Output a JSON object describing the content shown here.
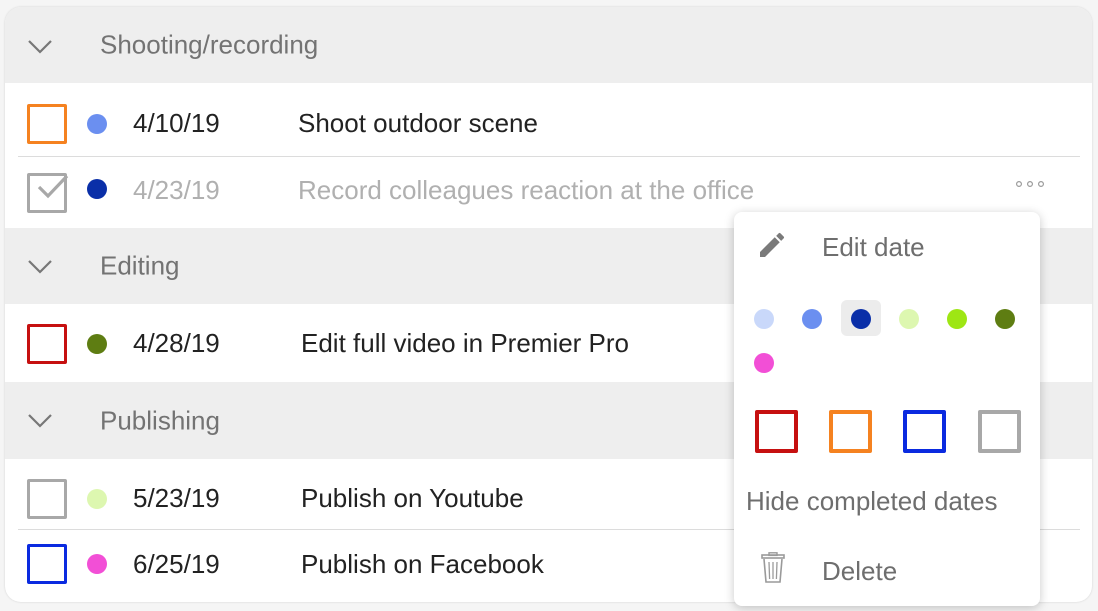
{
  "groups": [
    {
      "title": "Shooting/recording",
      "tasks": [
        {
          "date": "4/10/19",
          "label": "Shoot outdoor scene",
          "dot": "#6b8ff0",
          "box": "#f58220",
          "done": false
        },
        {
          "date": "4/23/19",
          "label": "Record colleagues reaction at the office",
          "dot": "#0a2fa8",
          "box": "#a8a8a8",
          "done": true
        }
      ]
    },
    {
      "title": "Editing",
      "tasks": [
        {
          "date": "4/28/19",
          "label": "Edit full video in Premier Pro",
          "dot": "#5e7d12",
          "box": "#c61010",
          "done": false
        }
      ]
    },
    {
      "title": "Publishing",
      "tasks": [
        {
          "date": "5/23/19",
          "label": "Publish on Youtube",
          "dot": "#ddf7b0",
          "box": "#a8a8a8",
          "done": false
        },
        {
          "date": "6/25/19",
          "label": "Publish on Facebook",
          "dot": "#f24fd6",
          "box": "#0a2ae0",
          "done": false
        }
      ]
    }
  ],
  "more_icon": "more-horizontal-icon",
  "menu": {
    "edit_date": "Edit date",
    "hide_completed": "Hide completed dates",
    "delete": "Delete",
    "dot_colors": [
      "#c9d8fa",
      "#6b8ff0",
      "#0a2fa8",
      "#ddf7b0",
      "#9ee614",
      "#5e7d12",
      "#f24fd6"
    ],
    "selected_dot": "#0a2fa8",
    "box_colors": [
      "#c61010",
      "#f58220",
      "#0a2ae0",
      "#a8a8a8"
    ]
  }
}
